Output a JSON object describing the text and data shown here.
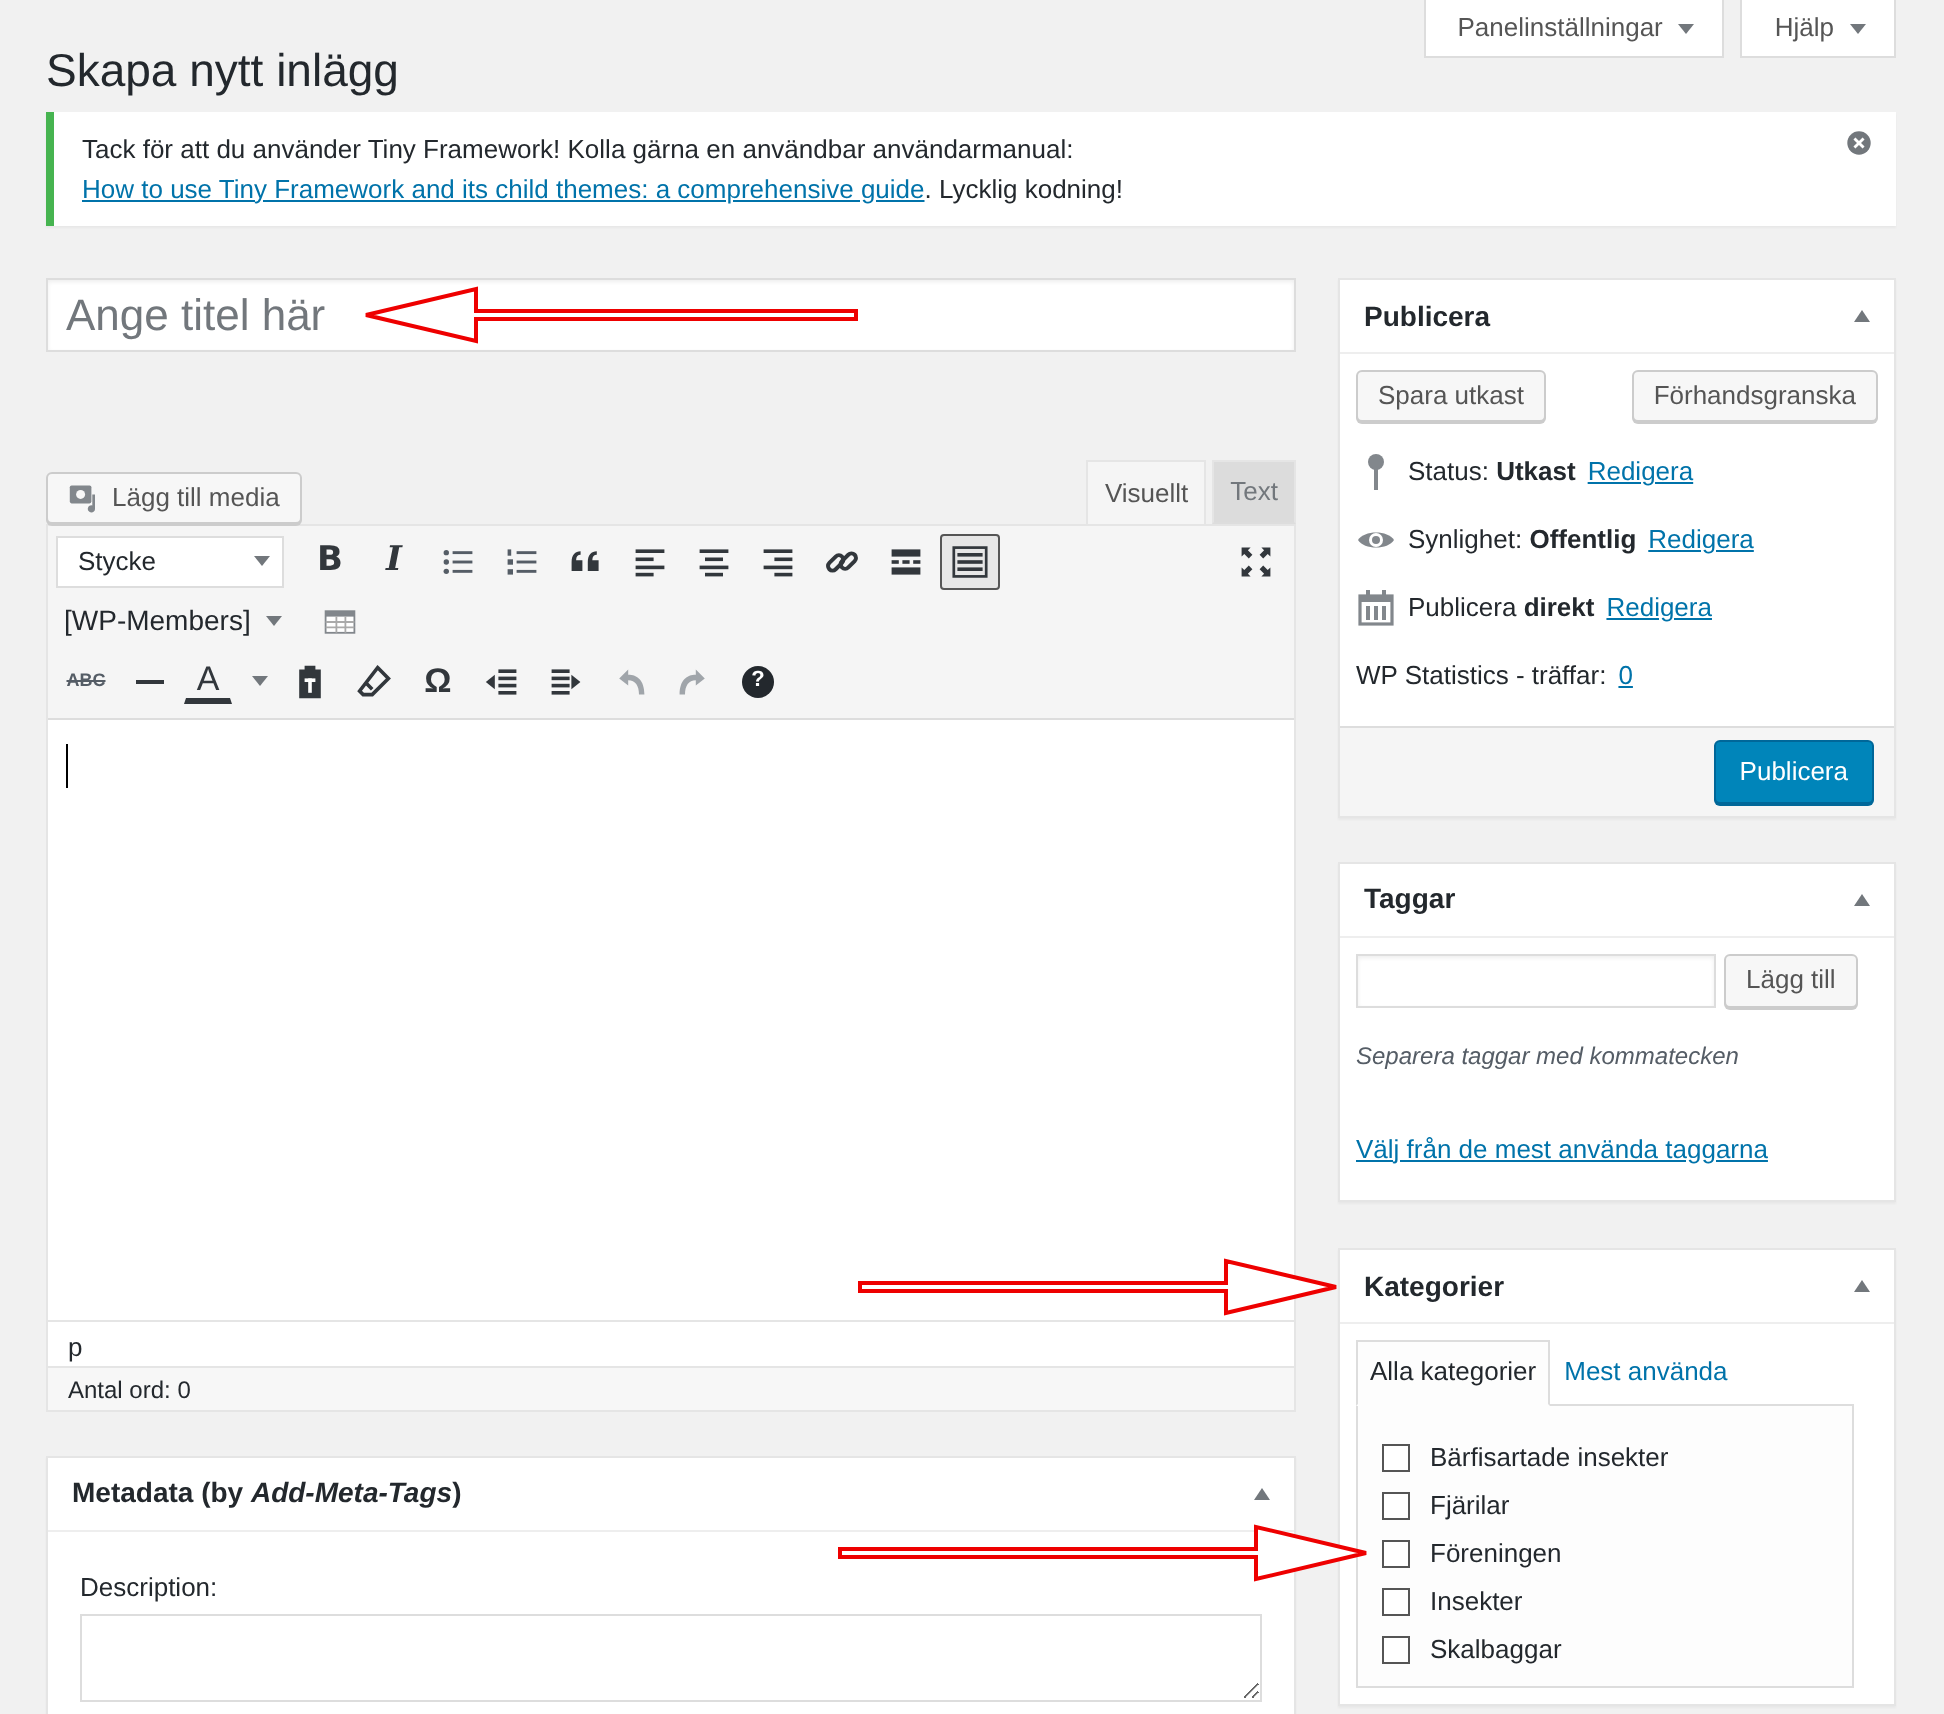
{
  "screen_meta": [
    {
      "label": "Panelinställningar"
    },
    {
      "label": "Hjälp"
    }
  ],
  "page_title": "Skapa nytt inlägg",
  "notice": {
    "text": "Tack för att du använder Tiny Framework! Kolla gärna en användbar användarmanual: ",
    "link": "How to use Tiny Framework and its child themes: a comprehensive guide",
    "after": ". Lycklig kodning!"
  },
  "title_field": {
    "placeholder": "Ange titel här"
  },
  "add_media": "Lägg till media",
  "editor_tabs": [
    {
      "label": "Visuellt",
      "selected": true
    },
    {
      "label": "Text",
      "selected": false
    }
  ],
  "toolbar": {
    "format": "Stycke",
    "bold": "B",
    "italic": "I",
    "kitchen_sink_on": true,
    "shortcode": "[WP-Members]",
    "strike": "ABC",
    "text_color": "A",
    "special_char": "Ω",
    "help": "?"
  },
  "path": "p",
  "word_count": "Antal ord: 0",
  "metadata": {
    "title": "Metadata (by *Add-Meta-Tags*)",
    "description_label": "Description:"
  },
  "publish": {
    "title": "Publicera",
    "save_draft": "Spara utkast",
    "preview": "Förhandsgranska",
    "rows": [
      {
        "kind": "status",
        "text": "Status: **Utkast**",
        "link": "Redigera"
      },
      {
        "kind": "visibility",
        "text": "Synlighet: **Offentlig**",
        "link": "Redigera"
      },
      {
        "kind": "schedule",
        "text": "Publicera **direkt**",
        "link": "Redigera"
      }
    ],
    "stats_label": "WP Statistics - träffar:",
    "stats_link": "0",
    "publish_button": "Publicera"
  },
  "tags": {
    "title": "Taggar",
    "add": "Lägg till",
    "hint": "Separera taggar med kommatecken",
    "link": "Välj från de mest använda taggarna"
  },
  "categories": {
    "title": "Kategorier",
    "tabs": [
      {
        "label": "Alla kategorier",
        "selected": true
      },
      {
        "label": "Mest använda",
        "selected": false
      }
    ],
    "items": [
      {
        "label": "Bärfisartade insekter",
        "checked": false
      },
      {
        "label": "Fjärilar",
        "checked": false
      },
      {
        "label": "Föreningen",
        "checked": false
      },
      {
        "label": "Insekter",
        "checked": false
      },
      {
        "label": "Skalbaggar",
        "checked": false
      }
    ]
  }
}
